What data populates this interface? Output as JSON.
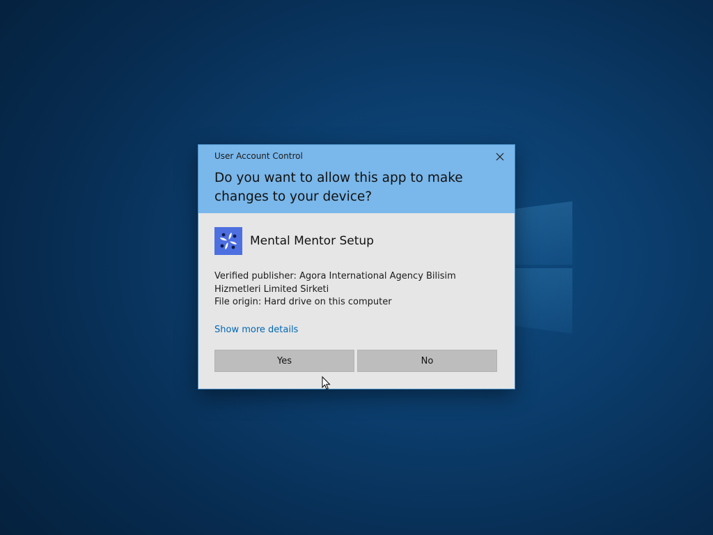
{
  "dialog": {
    "window_title": "User Account Control",
    "question": "Do you want to allow this app to make changes to your device?",
    "app_name": "Mental Mentor Setup",
    "publisher_label": "Verified publisher: Agora International Agency Bilisim Hizmetleri Limited Sirketi",
    "file_origin_label": "File origin: Hard drive on this computer",
    "show_more_details": "Show more details",
    "yes_label": "Yes",
    "no_label": "No"
  },
  "icons": {
    "close": "close-icon",
    "app": "mental-mentor-app-icon",
    "desktop_logo": "windows-logo",
    "cursor": "mouse-pointer"
  },
  "colors": {
    "header_bg": "#7ab7ea",
    "body_bg": "#e6e6e6",
    "button_bg": "#bdbdbd",
    "link": "#0066b4",
    "app_icon_bg": "#4d6fe0",
    "desktop_bg": "#0b3c6b"
  }
}
